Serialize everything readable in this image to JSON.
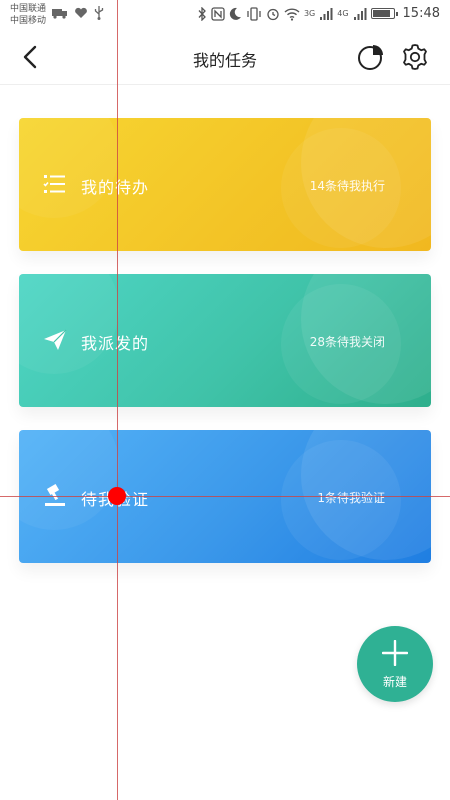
{
  "status_bar": {
    "carrier_1": "中国联通",
    "carrier_2": "中国移动",
    "net_1": "3G",
    "net_2": "4G",
    "time": "15:48",
    "battery_level": 0.8
  },
  "header": {
    "title": "我的任务",
    "icons": [
      "back-arrow-icon",
      "pie-chart-icon",
      "gear-icon"
    ]
  },
  "cards": [
    {
      "title": "我的待办",
      "meta": "14条待我执行",
      "icon": "task-list-icon"
    },
    {
      "title": "我派发的",
      "meta": "28条待我关闭",
      "icon": "paper-plane-icon"
    },
    {
      "title": "待我验证",
      "meta": "1条待我验证",
      "icon": "gavel-icon"
    }
  ],
  "fab": {
    "label": "新建",
    "icon": "plus-icon",
    "color": "#2fb194"
  },
  "colors": {
    "yellow": "#f3c527",
    "teal": "#40c3a9",
    "blue": "#3b98ea"
  }
}
